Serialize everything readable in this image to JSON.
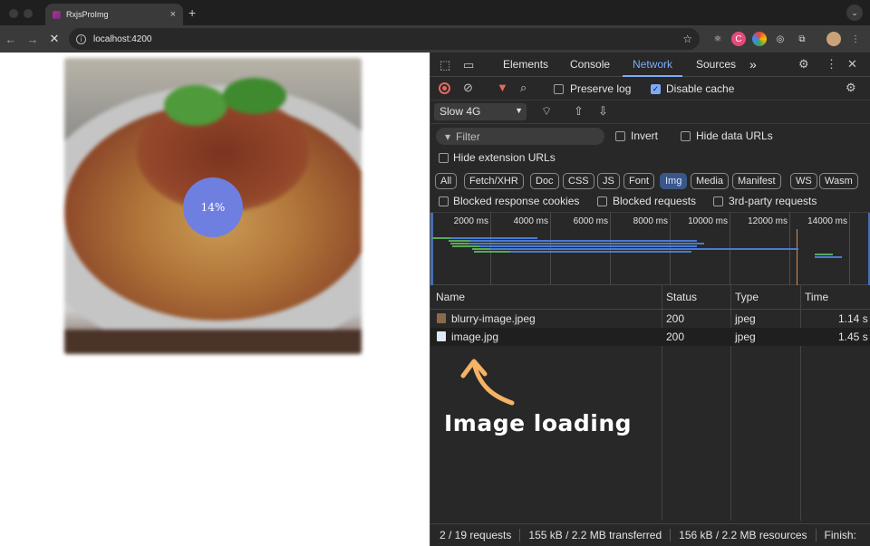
{
  "browser": {
    "tab_title": "RxjsProImg",
    "tab_close": "×",
    "new_tab": "+",
    "url": "localhost:4200"
  },
  "page": {
    "progress_label": "14%",
    "progress_value": 14
  },
  "devtools": {
    "tabs": [
      {
        "label": "Elements",
        "active": false
      },
      {
        "label": "Console",
        "active": false
      },
      {
        "label": "Network",
        "active": true
      },
      {
        "label": "Sources",
        "active": false
      }
    ],
    "more_tabs": "»",
    "preserve_log": {
      "label": "Preserve log",
      "checked": false
    },
    "disable_cache": {
      "label": "Disable cache",
      "checked": true
    },
    "throttling": "Slow 4G",
    "filter_placeholder": "Filter",
    "invert": {
      "label": "Invert",
      "checked": false
    },
    "hide_data_urls": {
      "label": "Hide data URLs",
      "checked": false
    },
    "hide_extension_urls": {
      "label": "Hide extension URLs",
      "checked": false
    },
    "type_filters": [
      {
        "label": "All",
        "selected": false
      },
      {
        "label": "Fetch/XHR",
        "selected": false
      },
      {
        "label": "Doc",
        "selected": false
      },
      {
        "label": "CSS",
        "selected": false
      },
      {
        "label": "JS",
        "selected": false
      },
      {
        "label": "Font",
        "selected": false
      },
      {
        "label": "Img",
        "selected": true
      },
      {
        "label": "Media",
        "selected": false
      },
      {
        "label": "Manifest",
        "selected": false
      },
      {
        "label": "WS",
        "selected": false
      },
      {
        "label": "Wasm",
        "selected": false
      }
    ],
    "blocked_response_cookies": {
      "label": "Blocked response cookies",
      "checked": false
    },
    "blocked_requests": {
      "label": "Blocked requests",
      "checked": false
    },
    "third_party_requests": {
      "label": "3rd-party requests",
      "checked": false
    },
    "timeline_ticks": [
      "2000 ms",
      "4000 ms",
      "6000 ms",
      "8000 ms",
      "10000 ms",
      "12000 ms",
      "14000 ms"
    ],
    "columns": [
      "Name",
      "Status",
      "Type",
      "Time"
    ],
    "requests": [
      {
        "name": "blurry-image.jpeg",
        "status": "200",
        "type": "jpeg",
        "time": "1.14 s"
      },
      {
        "name": "image.jpg",
        "status": "200",
        "type": "jpeg",
        "time": "1.45 s"
      }
    ],
    "status_bar": {
      "requests": "2 / 19 requests",
      "transferred": "155 kB / 2.2 MB transferred",
      "resources": "156 kB / 2.2 MB resources",
      "finish": "Finish:"
    }
  },
  "annotation": "Image loading",
  "colors": {
    "accent": "#7cacf8",
    "progress_circle": "#6f7fe0",
    "record": "#e46962",
    "annotation_arrow": "#f5b365"
  }
}
